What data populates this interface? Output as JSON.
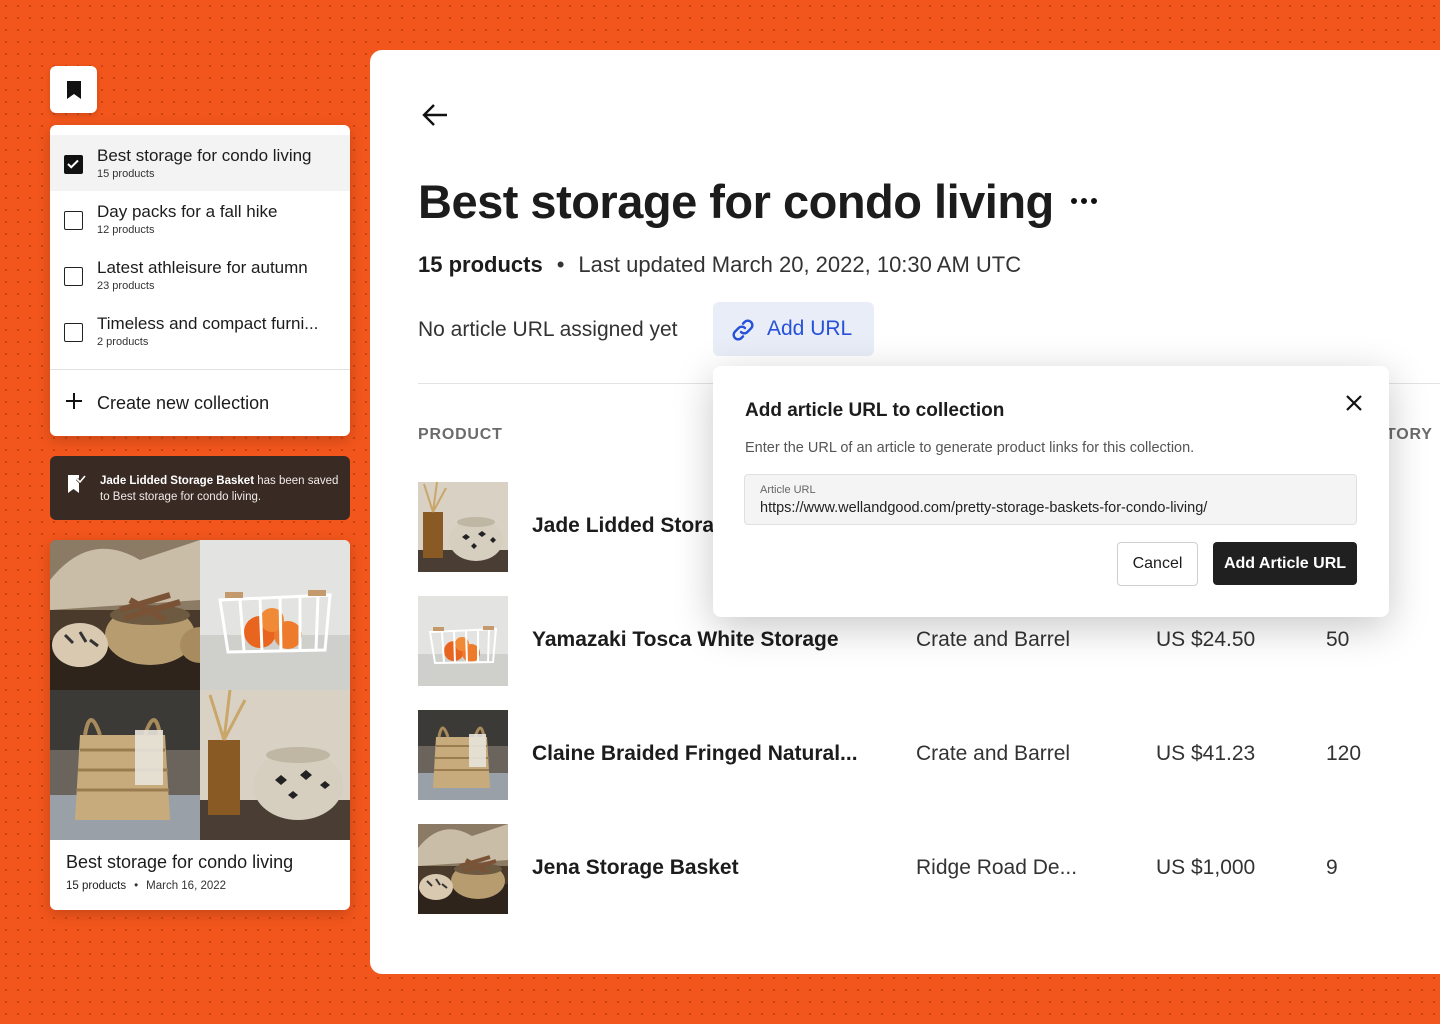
{
  "sidebar": {
    "collections": [
      {
        "title": "Best storage for condo living",
        "count": "15 products",
        "checked": true
      },
      {
        "title": "Day packs for a fall hike",
        "count": "12 products",
        "checked": false
      },
      {
        "title": "Latest athleisure for autumn",
        "count": "23 products",
        "checked": false
      },
      {
        "title": "Timeless and compact furni...",
        "count": "2 products",
        "checked": false
      }
    ],
    "create_label": "Create new collection"
  },
  "toast": {
    "product": "Jade Lidded Storage Basket",
    "message": " has been saved to Best storage for condo living."
  },
  "preview": {
    "title": "Best storage for condo living",
    "count": "15 products",
    "date": "March 16, 2022"
  },
  "main": {
    "title": "Best storage for condo living",
    "product_count": "15 products",
    "updated": "Last updated March 20, 2022, 10:30 AM UTC",
    "url_status": "No article URL assigned yet",
    "add_url_label": "Add URL",
    "columns": {
      "product": "PRODUCT",
      "inventory_partial": "TORY"
    },
    "rows": [
      {
        "name": "Jade Lidded Stora",
        "store": "",
        "price": "",
        "inventory": ""
      },
      {
        "name": "Yamazaki Tosca White Storage",
        "store": "Crate and Barrel",
        "price": "US $24.50",
        "inventory": "50"
      },
      {
        "name": "Claine Braided Fringed Natural...",
        "store": "Crate and Barrel",
        "price": "US $41.23",
        "inventory": "120"
      },
      {
        "name": "Jena Storage Basket",
        "store": "Ridge Road De...",
        "price": "US $1,000",
        "inventory": "9"
      }
    ]
  },
  "modal": {
    "title": "Add article URL to collection",
    "description": "Enter the URL of an article to generate product links for this collection.",
    "field_label": "Article URL",
    "field_value": "https://www.wellandgood.com/pretty-storage-baskets-for-condo-living/",
    "cancel_label": "Cancel",
    "submit_label": "Add Article URL"
  },
  "colors": {
    "background": "#f2561c",
    "accent_blue": "#2651d9",
    "toast_bg": "#3a2a24",
    "dark_button": "#202020"
  }
}
